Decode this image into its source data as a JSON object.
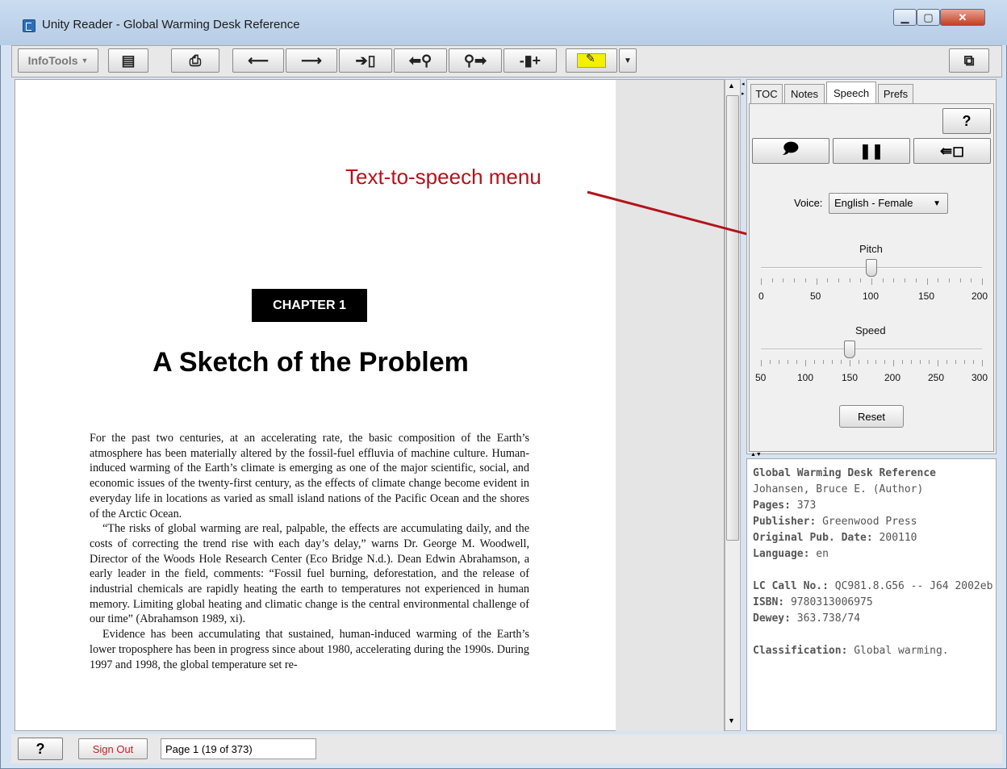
{
  "window": {
    "title": "Unity Reader - Global Warming Desk Reference"
  },
  "toolbar": {
    "infotools_label": "InfoTools",
    "icons": [
      "clipboard-icon",
      "print-icon",
      "arrow-left-icon",
      "arrow-right-icon",
      "goto-page-icon",
      "search-back-icon",
      "search-forward-icon",
      "bookmark-add-icon",
      "highlight-icon",
      "dropdown-icon",
      "fullscreen-icon"
    ]
  },
  "document": {
    "chapter_badge": "CHAPTER 1",
    "chapter_title": "A Sketch of the Problem",
    "paragraphs": [
      "For the past two centuries, at an accelerating rate, the basic composition of the Earth’s atmosphere has been materially altered by the fossil-fuel effluvia of machine culture. Human-induced warming of the Earth’s climate is emerging as one of the major scientific, social, and economic issues of the twenty-first century, as the effects of climate change become evident in everyday life in locations as varied as small island nations of the Pacific Ocean and the shores of the Arctic Ocean.",
      "“The risks of global warming are real, palpable, the effects are accumulating daily, and the costs of correcting the trend rise with each day’s delay,” warns Dr. George M. Woodwell, Director of the Woods Hole Research Center (Eco Bridge N.d.). Dean Edwin Abrahamson, a early leader in the field, comments: “Fossil fuel burning, deforestation, and the release of industrial chemicals are rapidly heating the earth to temperatures not experienced in human memory. Limiting global heating and climatic change is the central environmental challenge of our time” (Abrahamson 1989, xi).",
      "Evidence has been accumulating that sustained, human-induced warming of the Earth’s lower troposphere has been in progress since about 1980, accelerating during the 1990s. During 1997 and 1998, the global temperature set re-"
    ]
  },
  "annotation": {
    "callout": "Text-to-speech menu"
  },
  "side": {
    "tabs": [
      "TOC",
      "Notes",
      "Speech",
      "Prefs"
    ],
    "active_tab": "Speech",
    "help_label": "?",
    "voice_label": "Voice:",
    "voice_value": "English - Female",
    "pitch": {
      "label": "Pitch",
      "ticks": [
        "0",
        "50",
        "100",
        "150",
        "200"
      ],
      "value": 100,
      "min": 0,
      "max": 200
    },
    "speed": {
      "label": "Speed",
      "ticks": [
        "50",
        "100",
        "150",
        "200",
        "250",
        "300"
      ],
      "value": 150,
      "min": 50,
      "max": 300
    },
    "reset_label": "Reset"
  },
  "info": {
    "title": "Global Warming Desk Reference",
    "author": "Johansen, Bruce E. (Author)",
    "pages_label": "Pages:",
    "pages": "373",
    "publisher_label": "Publisher:",
    "publisher": "Greenwood Press",
    "pubdate_label": "Original Pub. Date:",
    "pubdate": "200110",
    "language_label": "Language:",
    "language": "en",
    "lc_label": "LC Call No.:",
    "lc": "QC981.8.G56 -- J64 2002eb",
    "isbn_label": "ISBN:",
    "isbn": "9780313006975",
    "dewey_label": "Dewey:",
    "dewey": "363.738/74",
    "class_label": "Classification:",
    "class": "Global warming."
  },
  "status": {
    "help_label": "?",
    "signout_label": "Sign Out",
    "page_text": "Page 1 (19 of 373)"
  },
  "colors": {
    "callout": "#b5121b",
    "signout": "#c0202a"
  }
}
